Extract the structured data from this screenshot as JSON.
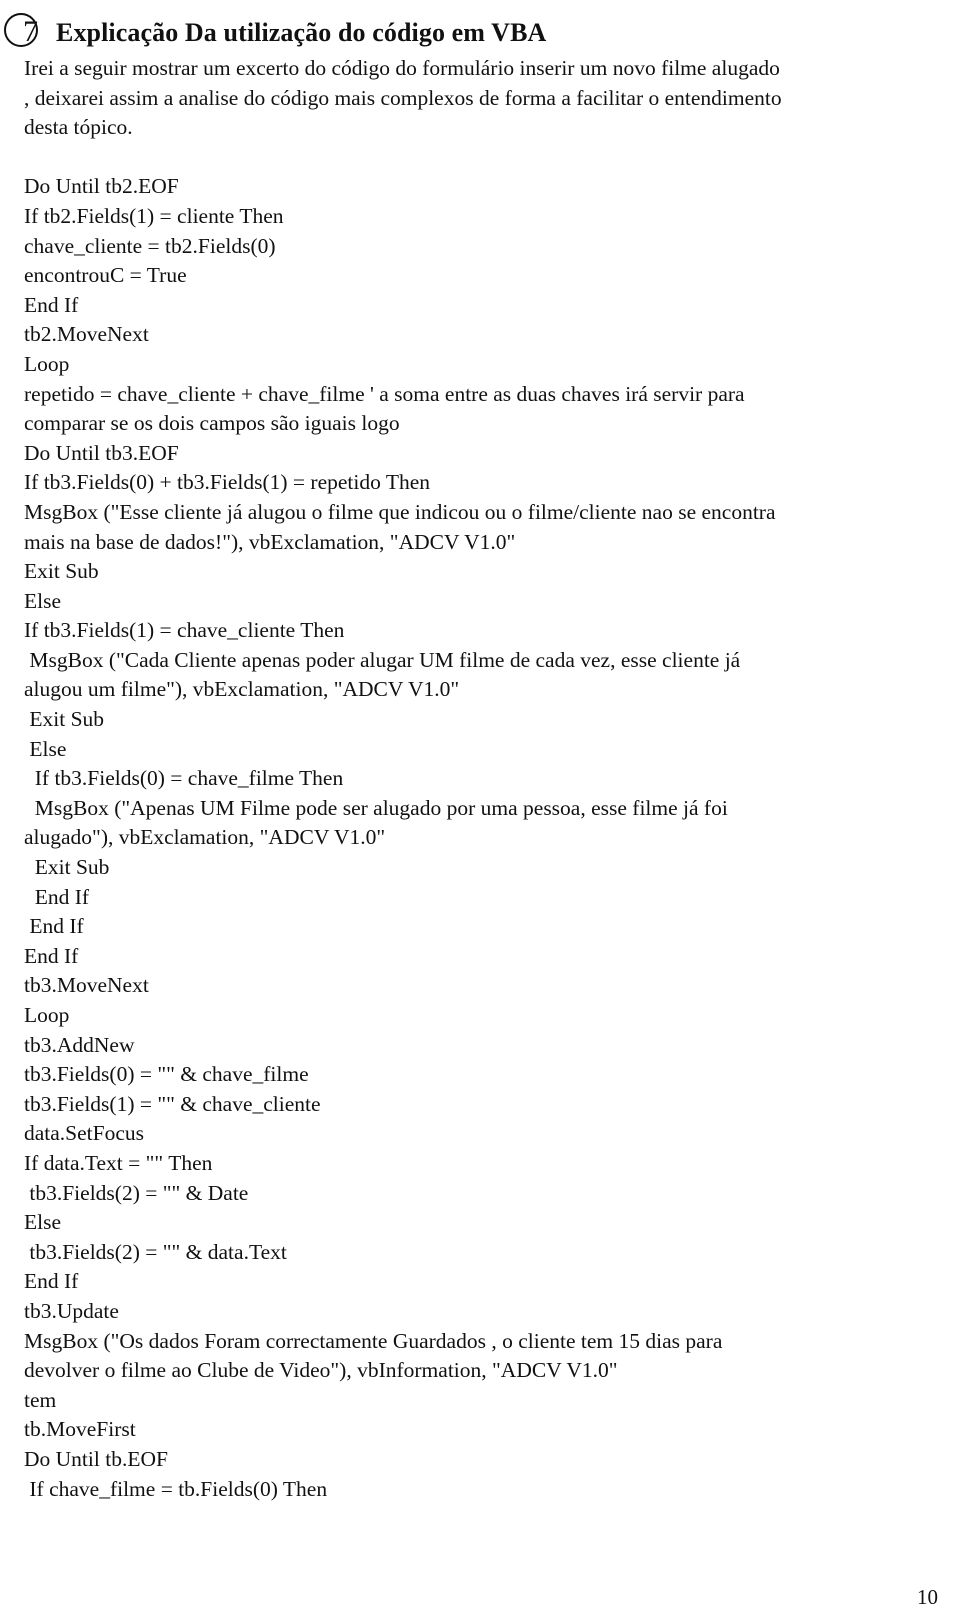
{
  "section": {
    "number": "7",
    "title": "Explicação Da utilização do código em VBA"
  },
  "intro_lines": [
    "Irei a seguir mostrar um excerto do código do formulário inserir um novo filme alugado",
    ", deixarei assim a analise do código mais complexos de forma a facilitar o entendimento",
    "desta tópico."
  ],
  "code_lines": [
    "Do Until tb2.EOF",
    "If tb2.Fields(1) = cliente Then",
    "chave_cliente = tb2.Fields(0)",
    "encontrouC = True",
    "End If",
    "tb2.MoveNext",
    "Loop",
    "repetido = chave_cliente + chave_filme ' a soma entre as duas chaves irá servir para",
    "comparar se os dois campos são iguais logo",
    "Do Until tb3.EOF",
    "If tb3.Fields(0) + tb3.Fields(1) = repetido Then",
    "MsgBox (\"Esse cliente já alugou o filme que indicou ou o filme/cliente nao se encontra",
    "mais na base de dados!\"), vbExclamation, \"ADCV V1.0\"",
    "Exit Sub",
    "Else",
    "If tb3.Fields(1) = chave_cliente Then",
    " MsgBox (\"Cada Cliente apenas poder alugar UM filme de cada vez, esse cliente já",
    "alugou um filme\"), vbExclamation, \"ADCV V1.0\"",
    " Exit Sub",
    " Else",
    "  If tb3.Fields(0) = chave_filme Then",
    "  MsgBox (\"Apenas UM Filme pode ser alugado por uma pessoa, esse filme já foi",
    "alugado\"), vbExclamation, \"ADCV V1.0\"",
    "  Exit Sub",
    "  End If",
    " End If",
    "End If",
    "tb3.MoveNext",
    "Loop",
    "tb3.AddNew",
    "tb3.Fields(0) = \"\" & chave_filme",
    "tb3.Fields(1) = \"\" & chave_cliente",
    "data.SetFocus",
    "If data.Text = \"\" Then",
    " tb3.Fields(2) = \"\" & Date",
    "Else",
    " tb3.Fields(2) = \"\" & data.Text",
    "End If",
    "tb3.Update",
    "MsgBox (\"Os dados Foram correctamente Guardados , o cliente tem 15 dias para",
    "devolver o filme ao Clube de Video\"), vbInformation, \"ADCV V1.0\"",
    "tem",
    "tb.MoveFirst",
    "Do Until tb.EOF",
    " If chave_filme = tb.Fields(0) Then"
  ],
  "page_number": "10"
}
